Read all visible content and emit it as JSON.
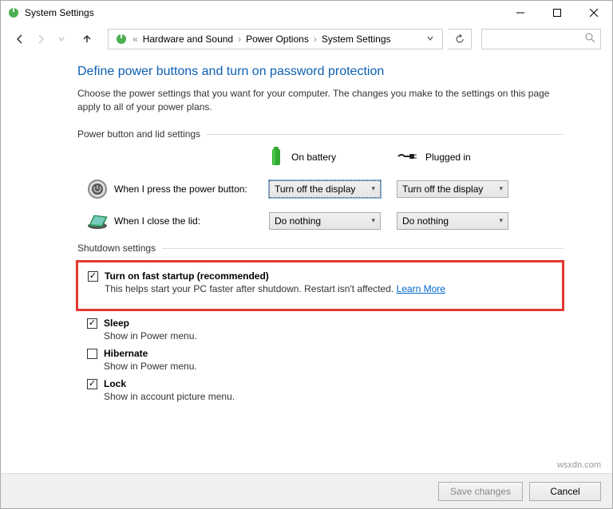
{
  "window": {
    "title": "System Settings"
  },
  "breadcrumb": {
    "prefix": "«",
    "items": [
      "Hardware and Sound",
      "Power Options",
      "System Settings"
    ]
  },
  "page": {
    "title": "Define power buttons and turn on password protection",
    "description": "Choose the power settings that you want for your computer. The changes you make to the settings on this page apply to all of your power plans."
  },
  "sections": {
    "power_lid": "Power button and lid settings",
    "shutdown": "Shutdown settings"
  },
  "columns": {
    "battery": "On battery",
    "plugged": "Plugged in"
  },
  "rows": {
    "power_button": {
      "label": "When I press the power button:",
      "battery": "Turn off the display",
      "plugged": "Turn off the display"
    },
    "lid": {
      "label": "When I close the lid:",
      "battery": "Do nothing",
      "plugged": "Do nothing"
    }
  },
  "shutdown": {
    "fast_startup": {
      "label": "Turn on fast startup (recommended)",
      "desc": "This helps start your PC faster after shutdown. Restart isn't affected.",
      "link": "Learn More",
      "checked": true
    },
    "sleep": {
      "label": "Sleep",
      "desc": "Show in Power menu.",
      "checked": true
    },
    "hibernate": {
      "label": "Hibernate",
      "desc": "Show in Power menu.",
      "checked": false
    },
    "lock": {
      "label": "Lock",
      "desc": "Show in account picture menu.",
      "checked": true
    }
  },
  "footer": {
    "save": "Save changes",
    "cancel": "Cancel"
  },
  "watermark": "wsxdn.com"
}
